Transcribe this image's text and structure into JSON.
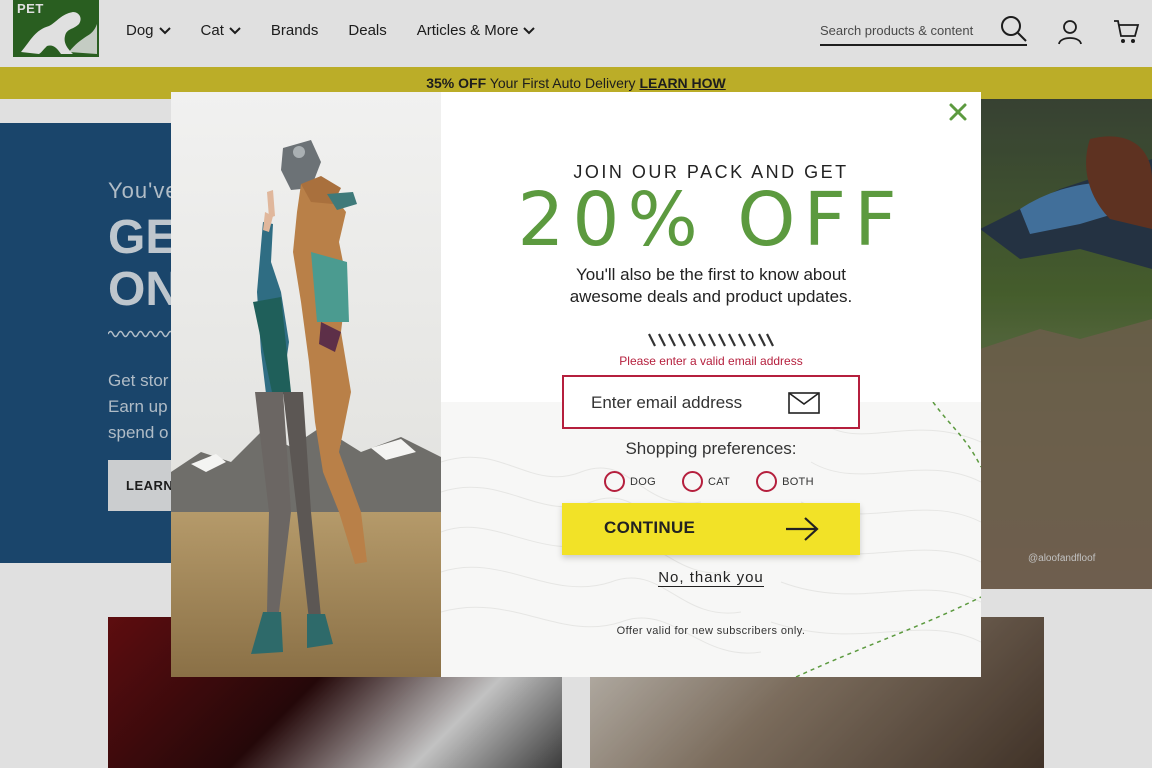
{
  "header": {
    "logo_text": "PET",
    "nav": [
      {
        "label": "Dog",
        "has_dropdown": true
      },
      {
        "label": "Cat",
        "has_dropdown": true
      },
      {
        "label": "Brands",
        "has_dropdown": false
      },
      {
        "label": "Deals",
        "has_dropdown": false
      },
      {
        "label": "Articles & More",
        "has_dropdown": true
      }
    ],
    "search": {
      "placeholder": "Search products & content",
      "icon": "search-icon"
    },
    "account_icon": "user-icon",
    "cart_icon": "cart-icon"
  },
  "promo": {
    "highlight": "35% OFF",
    "text": " Your First Auto Delivery ",
    "link": "LEARN HOW",
    "color": "#d5c52e"
  },
  "hero": {
    "eyebrow": "You've",
    "title_line1": "GE",
    "title_line2": "ON",
    "body_line1": "Get stor",
    "body_line2": "Earn up",
    "body_line3": "spend o",
    "button": "LEARN",
    "photo_credit": "@aloofandfloof",
    "color": "#1e4f7a"
  },
  "modal": {
    "eyebrow": "JOIN OUR PACK AND GET",
    "headline": "20% OFF",
    "sub_line1": "You'll also be the first to know about",
    "sub_line2": "awesome deals and product updates.",
    "error": "Please enter a valid email address",
    "email_placeholder": "Enter email address",
    "preferences_label": "Shopping preferences:",
    "options": [
      "DOG",
      "CAT",
      "BOTH"
    ],
    "continue_label": "CONTINUE",
    "no_thanks": "No, thank you",
    "fine_print": "Offer valid for new subscribers only.",
    "accent_color": "#5c9a3f",
    "error_color": "#b51f3d",
    "button_color": "#f2e227"
  }
}
